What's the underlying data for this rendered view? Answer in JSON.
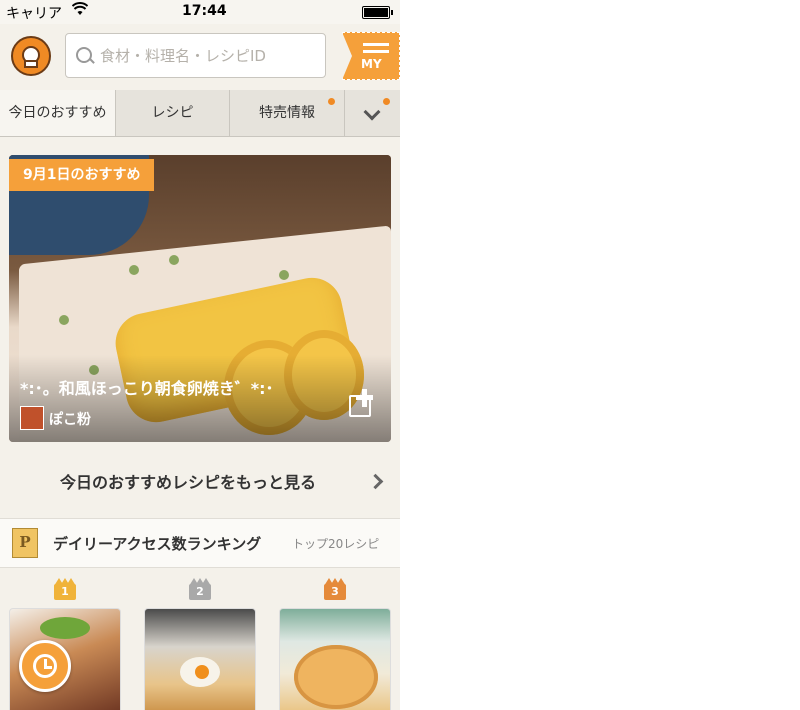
{
  "status_bar": {
    "carrier": "キャリア",
    "time": "17:44"
  },
  "header": {
    "search_placeholder": "食材・料理名・レシピID",
    "my_label": "MY"
  },
  "tabs": [
    {
      "label": "今日のおすすめ"
    },
    {
      "label": "レシピ"
    },
    {
      "label": "特売情報"
    }
  ],
  "featured": {
    "badge": "9月1日のおすすめ",
    "title": "*:･。和風ほっこり朝食卵焼き゛*:･",
    "author": "ぽこ粉"
  },
  "more_link": "今日のおすすめレシピをもっと見る",
  "ranking": {
    "icon_letter": "P",
    "title": "デイリーアクセス数ランキング",
    "subtitle": "トップ20レシピ",
    "ranks": [
      "1",
      "2",
      "3"
    ]
  },
  "colors": {
    "accent": "#f5a03a",
    "brown": "#6b3b16"
  }
}
